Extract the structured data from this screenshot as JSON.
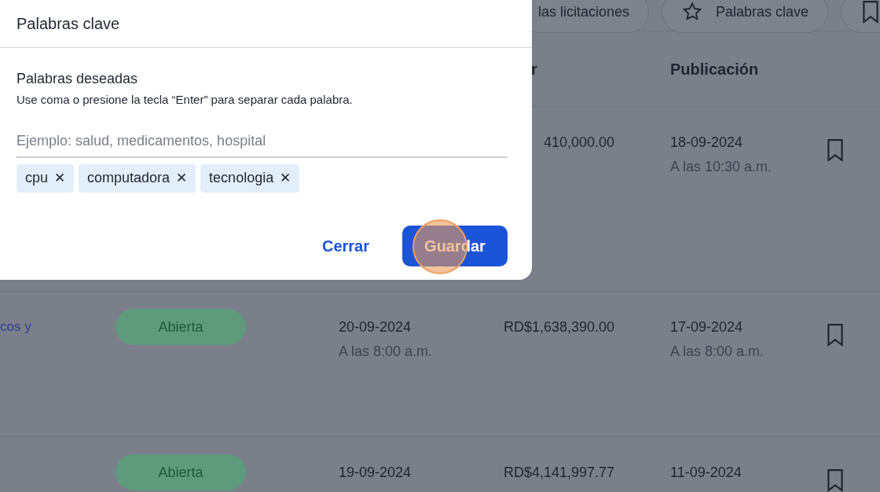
{
  "background": {
    "filter_buttons": [
      {
        "label": "las licitaciones",
        "kind": "text"
      },
      {
        "label": "Palabras clave",
        "kind": "star"
      },
      {
        "kind": "bookmark"
      }
    ],
    "table": {
      "columns": [
        {
          "label": "r"
        },
        {
          "label": "Publicación"
        }
      ],
      "rows": [
        {
          "amount": "410,000.00",
          "published": "18-09-2024",
          "published_time": "A las 10:30 a.m.",
          "saved": false
        },
        {
          "title": "cos y",
          "status": "Abierta",
          "deadline": "20-09-2024",
          "deadline_time": "A las 8:00 a.m.",
          "amount": "RD$1,638,390.00",
          "published": "17-09-2024",
          "published_time": "A las 8:00 a.m.",
          "saved": false
        },
        {
          "status": "Abierta",
          "deadline": "19-09-2024",
          "amount": "RD$4,141,997.77",
          "published": "11-09-2024",
          "saved": false
        }
      ]
    }
  },
  "modal": {
    "title": "Palabras clave",
    "section_title": "Palabras deseadas",
    "hint": "Use coma o presione la tecla “Enter” para separar cada palabra.",
    "input": {
      "placeholder": "Ejemplo: salud, medicamentos, hospital"
    },
    "tags": [
      {
        "label": "cpu",
        "remove": "✕"
      },
      {
        "label": "computadora",
        "remove": "✕"
      },
      {
        "label": "tecnologia",
        "remove": "✕"
      }
    ],
    "buttons": [
      {
        "label": "Cerrar",
        "kind": "text"
      },
      {
        "label": "Guardar",
        "kind": "primary"
      }
    ]
  }
}
